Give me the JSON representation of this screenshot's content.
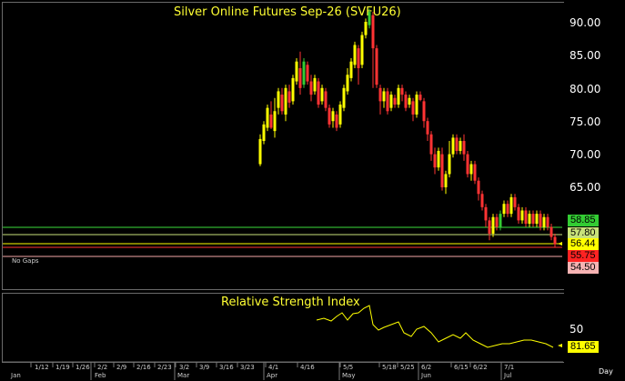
{
  "main": {
    "title": "Silver Online Futures Sep-26 (SVFU26)",
    "no_gaps_label": "No Gaps",
    "price_axis": [
      "90.00",
      "85.00",
      "80.00",
      "75.00",
      "70.00",
      "65.00"
    ],
    "levels": [
      {
        "label": "58.85",
        "value": 58.85,
        "line_color": "#3ddc3d",
        "bg": "#33cc33",
        "fg": "#000000"
      },
      {
        "label": "57.80",
        "value": 57.8,
        "line_color": "#c8e27a",
        "bg": "#c8e27a",
        "fg": "#000000"
      },
      {
        "label": "56.44",
        "value": 56.44,
        "line_color": "#ffff00",
        "bg": "#ffff00",
        "fg": "#000000"
      },
      {
        "label": "55.75",
        "value": 55.75,
        "line_color": "#ff3333",
        "bg": "#ff2222",
        "fg": "#000000"
      },
      {
        "label": "54.50",
        "value": 54.5,
        "line_color": "#f4a7a7",
        "bg": "#f6b3b3",
        "fg": "#000000"
      }
    ]
  },
  "rsi": {
    "title": "Relative Strength Index",
    "axis_label": "50",
    "current_label": "81.65",
    "current_bg": "#ffff00"
  },
  "x_axis": {
    "ticks": [
      "1/12",
      "1/19",
      "1/26",
      "2/2",
      "2/9",
      "2/16",
      "2/23",
      "3/2",
      "3/9",
      "3/16",
      "3/23",
      "4/1",
      "4/16",
      "5/5",
      "5/18",
      "5/25",
      "6/2",
      "6/15",
      "6/22",
      "7/1"
    ],
    "months": [
      "Jan",
      "Feb",
      "Mar",
      "Apr",
      "May",
      "Jun",
      "Jul"
    ],
    "period_label": "Day"
  },
  "colors": {
    "up": "#ffff00",
    "down": "#ff3333",
    "up_alt": "#33cc33"
  }
}
